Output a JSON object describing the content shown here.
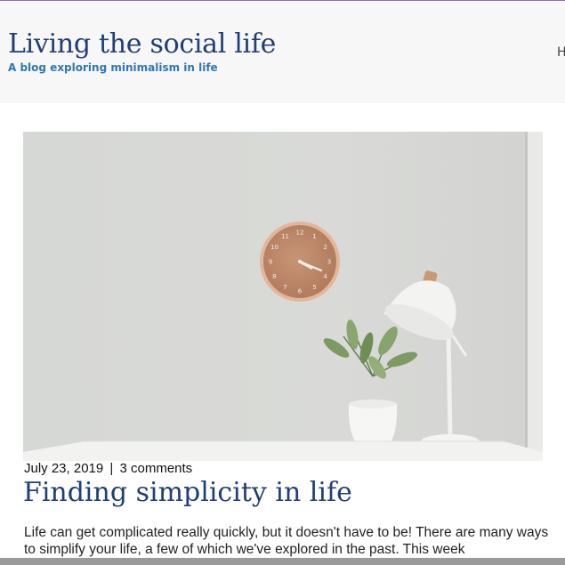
{
  "header": {
    "site_title": "Living the social life",
    "tagline": "A blog exploring minimalism in life",
    "nav_partial": "H"
  },
  "post": {
    "date": "July 23, 2019",
    "separator": "|",
    "comments": "3 comments",
    "title": "Finding simplicity in life",
    "excerpt": "Life can get complicated really quickly, but it doesn't have to be! There are many ways to simplify your life, a few of which we've explored in the past. This week",
    "image": {
      "clock_numbers": [
        "12",
        "1",
        "2",
        "3",
        "4",
        "5",
        "6",
        "7",
        "8",
        "9",
        "10",
        "11"
      ]
    }
  },
  "colors": {
    "title": "#1f3f76",
    "tagline": "#2d79b8",
    "header_bg": "#f7f7f7"
  }
}
